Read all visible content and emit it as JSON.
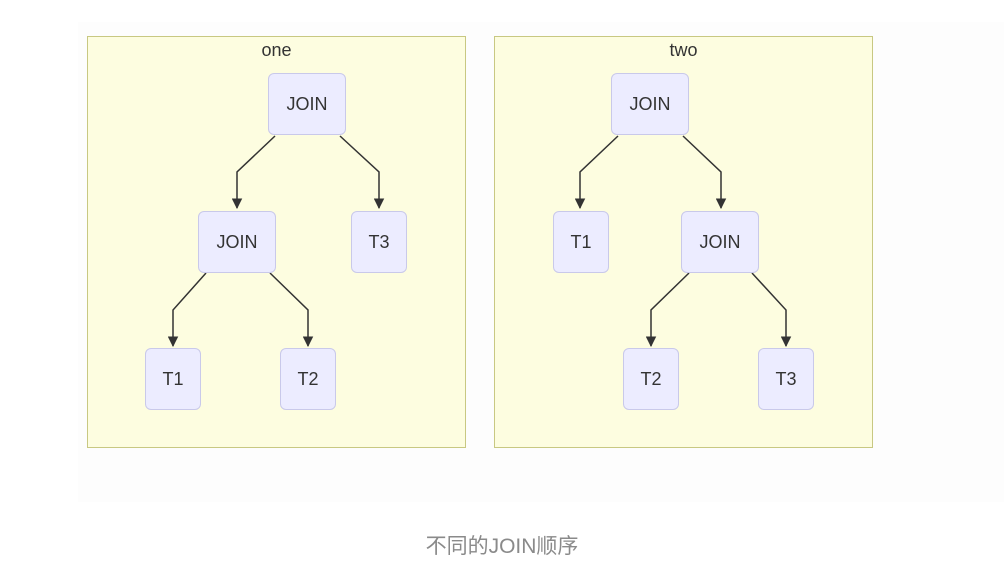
{
  "diagram": {
    "clusters": [
      {
        "title": "one",
        "nodes": {
          "root": "JOIN",
          "inner_join": "JOIN",
          "t1": "T1",
          "t2": "T2",
          "t3": "T3"
        },
        "edges": [
          [
            "root",
            "inner_join"
          ],
          [
            "root",
            "t3"
          ],
          [
            "inner_join",
            "t1"
          ],
          [
            "inner_join",
            "t2"
          ]
        ]
      },
      {
        "title": "two",
        "nodes": {
          "root": "JOIN",
          "t1": "T1",
          "inner_join": "JOIN",
          "t2": "T2",
          "t3": "T3"
        },
        "edges": [
          [
            "root",
            "t1"
          ],
          [
            "root",
            "inner_join"
          ],
          [
            "inner_join",
            "t2"
          ],
          [
            "inner_join",
            "t3"
          ]
        ]
      }
    ],
    "colors": {
      "cluster_fill": "#fdfde0",
      "cluster_border": "#c8c882",
      "node_fill": "#ececff",
      "node_border": "#c9c9ea",
      "edge": "#333333"
    }
  },
  "caption": "不同的JOIN顺序"
}
